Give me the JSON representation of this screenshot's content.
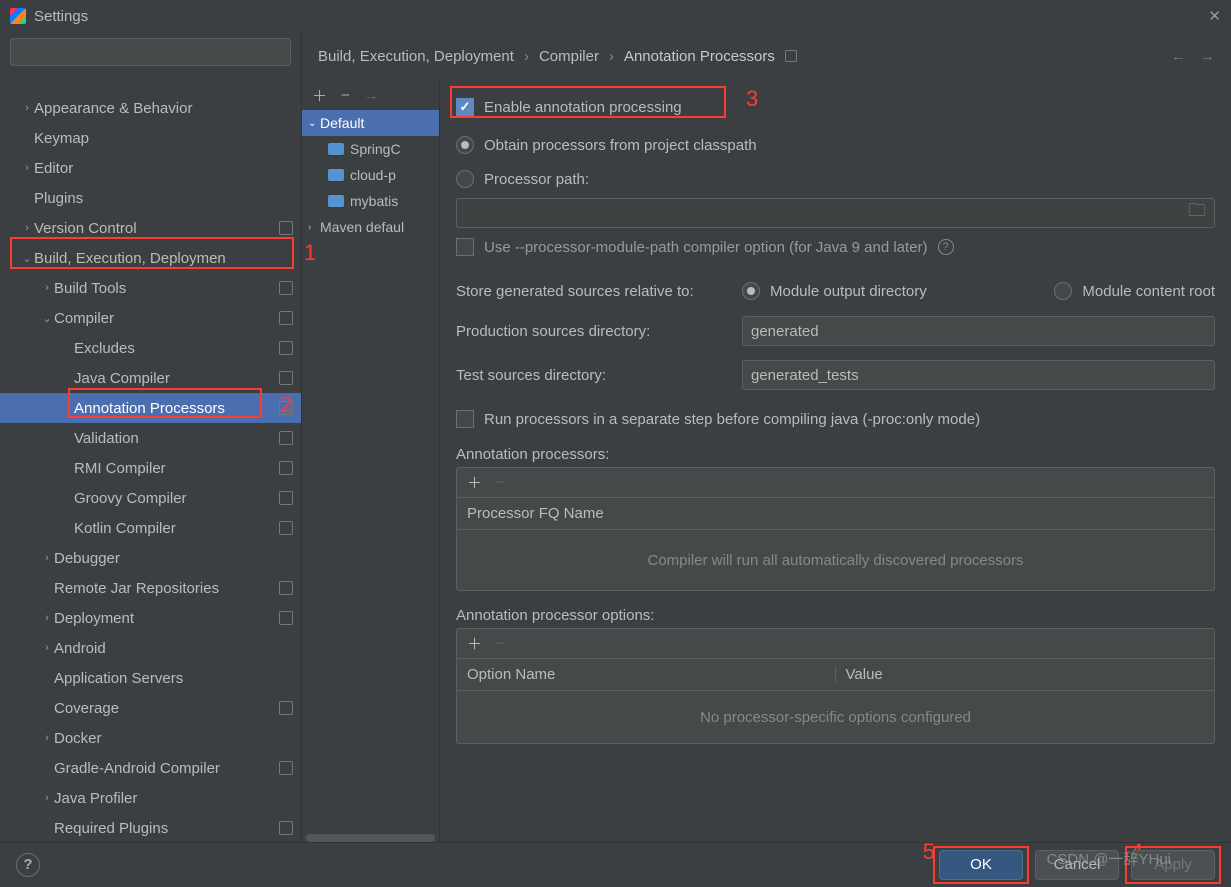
{
  "title": "Settings",
  "search": {
    "placeholder": ""
  },
  "sidebar": {
    "items": [
      {
        "label": "Appearance & Behavior",
        "chev": "›",
        "ind": 0,
        "badge": false
      },
      {
        "label": "Keymap",
        "chev": "",
        "ind": 0,
        "badge": false
      },
      {
        "label": "Editor",
        "chev": "›",
        "ind": 0,
        "badge": false
      },
      {
        "label": "Plugins",
        "chev": "",
        "ind": 0,
        "badge": false
      },
      {
        "label": "Version Control",
        "chev": "›",
        "ind": 0,
        "badge": true
      },
      {
        "label": "Build, Execution, Deploymen",
        "chev": "⌄",
        "ind": 0,
        "badge": false,
        "hl": 1
      },
      {
        "label": "Build Tools",
        "chev": "›",
        "ind": 1,
        "badge": true
      },
      {
        "label": "Compiler",
        "chev": "⌄",
        "ind": 1,
        "badge": true
      },
      {
        "label": "Excludes",
        "chev": "",
        "ind": 2,
        "badge": true
      },
      {
        "label": "Java Compiler",
        "chev": "",
        "ind": 2,
        "badge": true
      },
      {
        "label": "Annotation Processors",
        "chev": "",
        "ind": 2,
        "badge": true,
        "sel": true,
        "hl": 2
      },
      {
        "label": "Validation",
        "chev": "",
        "ind": 2,
        "badge": true
      },
      {
        "label": "RMI Compiler",
        "chev": "",
        "ind": 2,
        "badge": true
      },
      {
        "label": "Groovy Compiler",
        "chev": "",
        "ind": 2,
        "badge": true
      },
      {
        "label": "Kotlin Compiler",
        "chev": "",
        "ind": 2,
        "badge": true
      },
      {
        "label": "Debugger",
        "chev": "›",
        "ind": 1,
        "badge": false
      },
      {
        "label": "Remote Jar Repositories",
        "chev": "",
        "ind": 1,
        "badge": true
      },
      {
        "label": "Deployment",
        "chev": "›",
        "ind": 1,
        "badge": true
      },
      {
        "label": "Android",
        "chev": "›",
        "ind": 1,
        "badge": false
      },
      {
        "label": "Application Servers",
        "chev": "",
        "ind": 1,
        "badge": false
      },
      {
        "label": "Coverage",
        "chev": "",
        "ind": 1,
        "badge": true
      },
      {
        "label": "Docker",
        "chev": "›",
        "ind": 1,
        "badge": false
      },
      {
        "label": "Gradle-Android Compiler",
        "chev": "",
        "ind": 1,
        "badge": true
      },
      {
        "label": "Java Profiler",
        "chev": "›",
        "ind": 1,
        "badge": false
      },
      {
        "label": "Required Plugins",
        "chev": "",
        "ind": 1,
        "badge": true
      }
    ]
  },
  "breadcrumb": {
    "a": "Build, Execution, Deployment",
    "b": "Compiler",
    "c": "Annotation Processors"
  },
  "modules": {
    "default": "Default",
    "items": [
      "SpringC",
      "cloud-p",
      "mybatis"
    ],
    "maven": "Maven defaul"
  },
  "form": {
    "enable": "Enable annotation processing",
    "obtain": "Obtain processors from project classpath",
    "procpath": "Processor path:",
    "modulepath": "Use --processor-module-path compiler option (for Java 9 and later)",
    "store": "Store generated sources relative to:",
    "store_a": "Module output directory",
    "store_b": "Module content root",
    "prod_label": "Production sources directory:",
    "prod_value": "generated",
    "test_label": "Test sources directory:",
    "test_value": "generated_tests",
    "separate": "Run processors in a separate step before compiling java (-proc:only mode)",
    "procs_label": "Annotation processors:",
    "procs_header": "Processor FQ Name",
    "procs_empty": "Compiler will run all automatically discovered processors",
    "opts_label": "Annotation processor options:",
    "opts_h1": "Option Name",
    "opts_h2": "Value",
    "opts_empty": "No processor-specific options configured"
  },
  "buttons": {
    "ok": "OK",
    "cancel": "Cancel",
    "apply": "Apply"
  },
  "annotations": {
    "n1": "1",
    "n2": "2",
    "n3": "3",
    "n4": "4",
    "n5": "5"
  },
  "watermark": "CSDN @一辞YHui"
}
